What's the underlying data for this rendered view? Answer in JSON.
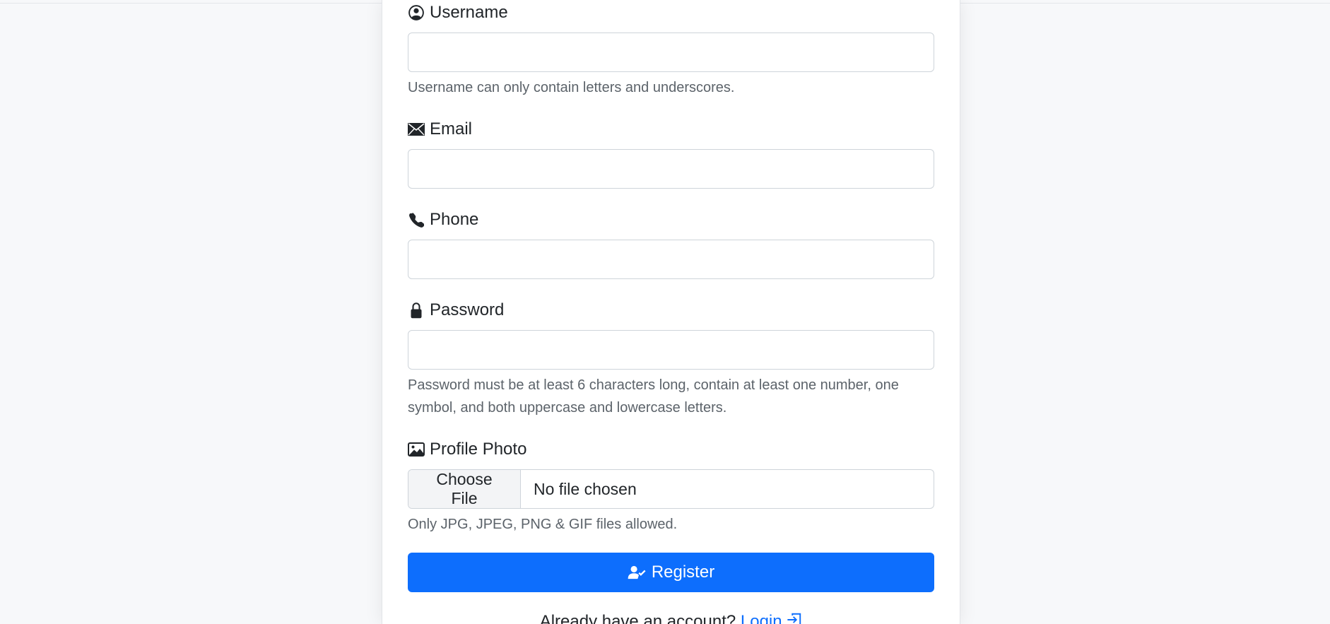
{
  "form": {
    "username": {
      "label": "Username",
      "icon": "person-circle-icon",
      "value": "",
      "help": "Username can only contain letters and underscores."
    },
    "email": {
      "label": "Email",
      "icon": "envelope-icon",
      "value": ""
    },
    "phone": {
      "label": "Phone",
      "icon": "telephone-icon",
      "value": ""
    },
    "password": {
      "label": "Password",
      "icon": "lock-icon",
      "value": "",
      "help": "Password must be at least 6 characters long, contain at least one number, one symbol, and both uppercase and lowercase letters."
    },
    "photo": {
      "label": "Profile Photo",
      "icon": "image-icon",
      "button_label": "Choose File",
      "status": "No file chosen",
      "help": "Only JPG, JPEG, PNG & GIF files allowed."
    },
    "submit": {
      "label": "Register",
      "icon": "person-check-icon"
    }
  },
  "footer": {
    "prompt": "Already have an account?",
    "login_label": "Login",
    "login_icon": "box-arrow-in-right-icon"
  },
  "colors": {
    "accent": "#0d6efd",
    "background": "#f7f8fa",
    "border": "#ced4da",
    "help_text": "#5c636a"
  }
}
